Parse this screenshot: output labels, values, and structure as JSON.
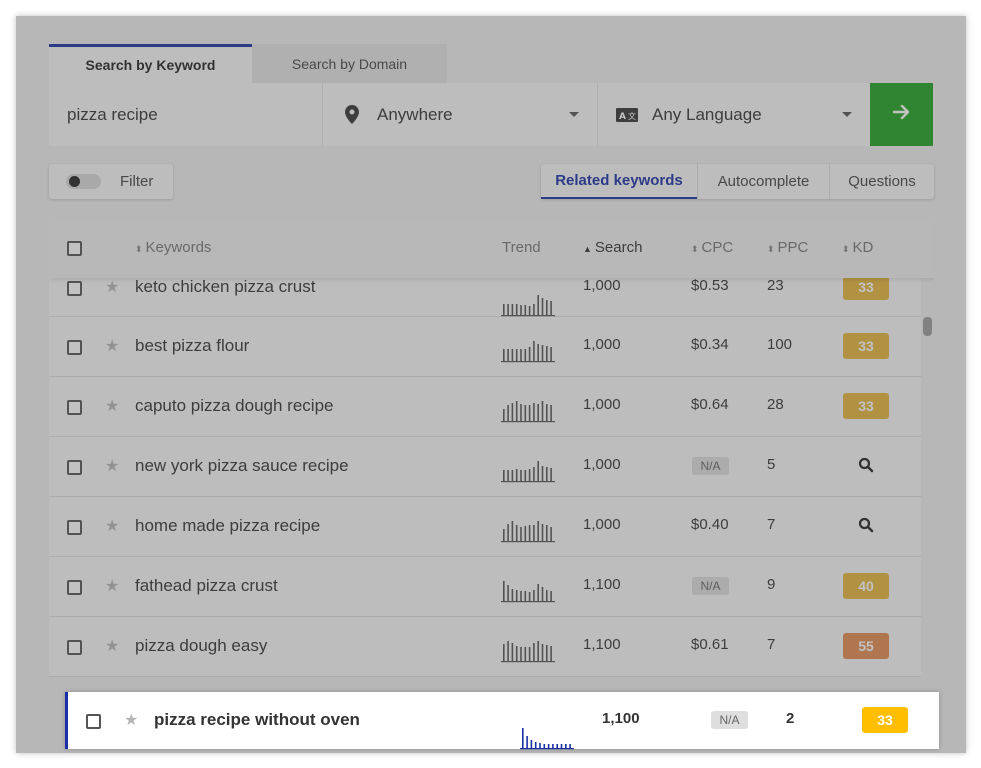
{
  "tabs": [
    {
      "label": "Search by Keyword",
      "active": true
    },
    {
      "label": "Search by Domain",
      "active": false
    }
  ],
  "search": {
    "keyword": "pizza recipe",
    "location": "Anywhere",
    "language": "Any Language",
    "go_icon": "arrow-right-icon"
  },
  "filter": {
    "label": "Filter",
    "enabled": false
  },
  "modes": [
    {
      "label": "Related keywords",
      "active": true
    },
    {
      "label": "Autocomplete",
      "active": false
    },
    {
      "label": "Questions",
      "active": false
    }
  ],
  "table": {
    "headers": {
      "keywords": "Keywords",
      "trend": "Trend",
      "search": "Search",
      "cpc": "CPC",
      "ppc": "PPC",
      "kd": "KD"
    },
    "rows": [
      {
        "keyword": "keto chicken pizza crust",
        "search": "1,000",
        "cpc": "$0.53",
        "ppc": "23",
        "kd": "33",
        "kd_color": "#e3b53b",
        "trend": [
          0.55,
          0.55,
          0.55,
          0.55,
          0.5,
          0.5,
          0.45,
          0.55,
          1.0,
          0.85,
          0.75,
          0.7
        ]
      },
      {
        "keyword": "best pizza flour",
        "search": "1,000",
        "cpc": "$0.34",
        "ppc": "100",
        "kd": "33",
        "kd_color": "#e3b53b",
        "trend": [
          0.6,
          0.6,
          0.6,
          0.6,
          0.6,
          0.6,
          0.7,
          1.0,
          0.85,
          0.8,
          0.75,
          0.7
        ]
      },
      {
        "keyword": "caputo pizza dough recipe",
        "search": "1,000",
        "cpc": "$0.64",
        "ppc": "28",
        "kd": "33",
        "kd_color": "#e3b53b",
        "trend": [
          0.6,
          0.8,
          0.9,
          1.0,
          0.85,
          0.8,
          0.8,
          0.9,
          0.85,
          1.0,
          0.85,
          0.8
        ]
      },
      {
        "keyword": "new york pizza sauce recipe",
        "search": "1,000",
        "cpc": "N/A",
        "ppc": "5",
        "kd": "",
        "kd_color": "",
        "trend": [
          0.55,
          0.55,
          0.55,
          0.6,
          0.55,
          0.55,
          0.6,
          0.7,
          1.0,
          0.75,
          0.7,
          0.65
        ]
      },
      {
        "keyword": "home made pizza recipe",
        "search": "1,000",
        "cpc": "$0.40",
        "ppc": "7",
        "kd": "",
        "kd_color": "",
        "trend": [
          0.6,
          0.85,
          1.0,
          0.8,
          0.7,
          0.75,
          0.8,
          0.8,
          1.0,
          0.85,
          0.8,
          0.7
        ]
      },
      {
        "keyword": "fathead pizza crust",
        "search": "1,100",
        "cpc": "N/A",
        "ppc": "9",
        "kd": "40",
        "kd_color": "#e3b53b",
        "trend": [
          1.0,
          0.8,
          0.6,
          0.55,
          0.5,
          0.5,
          0.45,
          0.55,
          0.85,
          0.7,
          0.55,
          0.5
        ]
      },
      {
        "keyword": "pizza dough easy",
        "search": "1,100",
        "cpc": "$0.61",
        "ppc": "7",
        "kd": "55",
        "kd_color": "#e28a4f",
        "trend": [
          0.85,
          1.0,
          0.9,
          0.75,
          0.7,
          0.7,
          0.7,
          0.9,
          1.0,
          0.85,
          0.8,
          0.75
        ]
      }
    ],
    "highlight_row": {
      "keyword": "pizza recipe without oven",
      "search": "1,100",
      "cpc": "N/A",
      "ppc": "2",
      "kd": "33",
      "kd_color": "#ffbf00",
      "trend": [
        1.0,
        0.6,
        0.4,
        0.3,
        0.25,
        0.2,
        0.2,
        0.2,
        0.2,
        0.2,
        0.2,
        0.2
      ]
    }
  },
  "colors": {
    "accent": "#1a2fa6",
    "go_button": "#1fa31f"
  }
}
